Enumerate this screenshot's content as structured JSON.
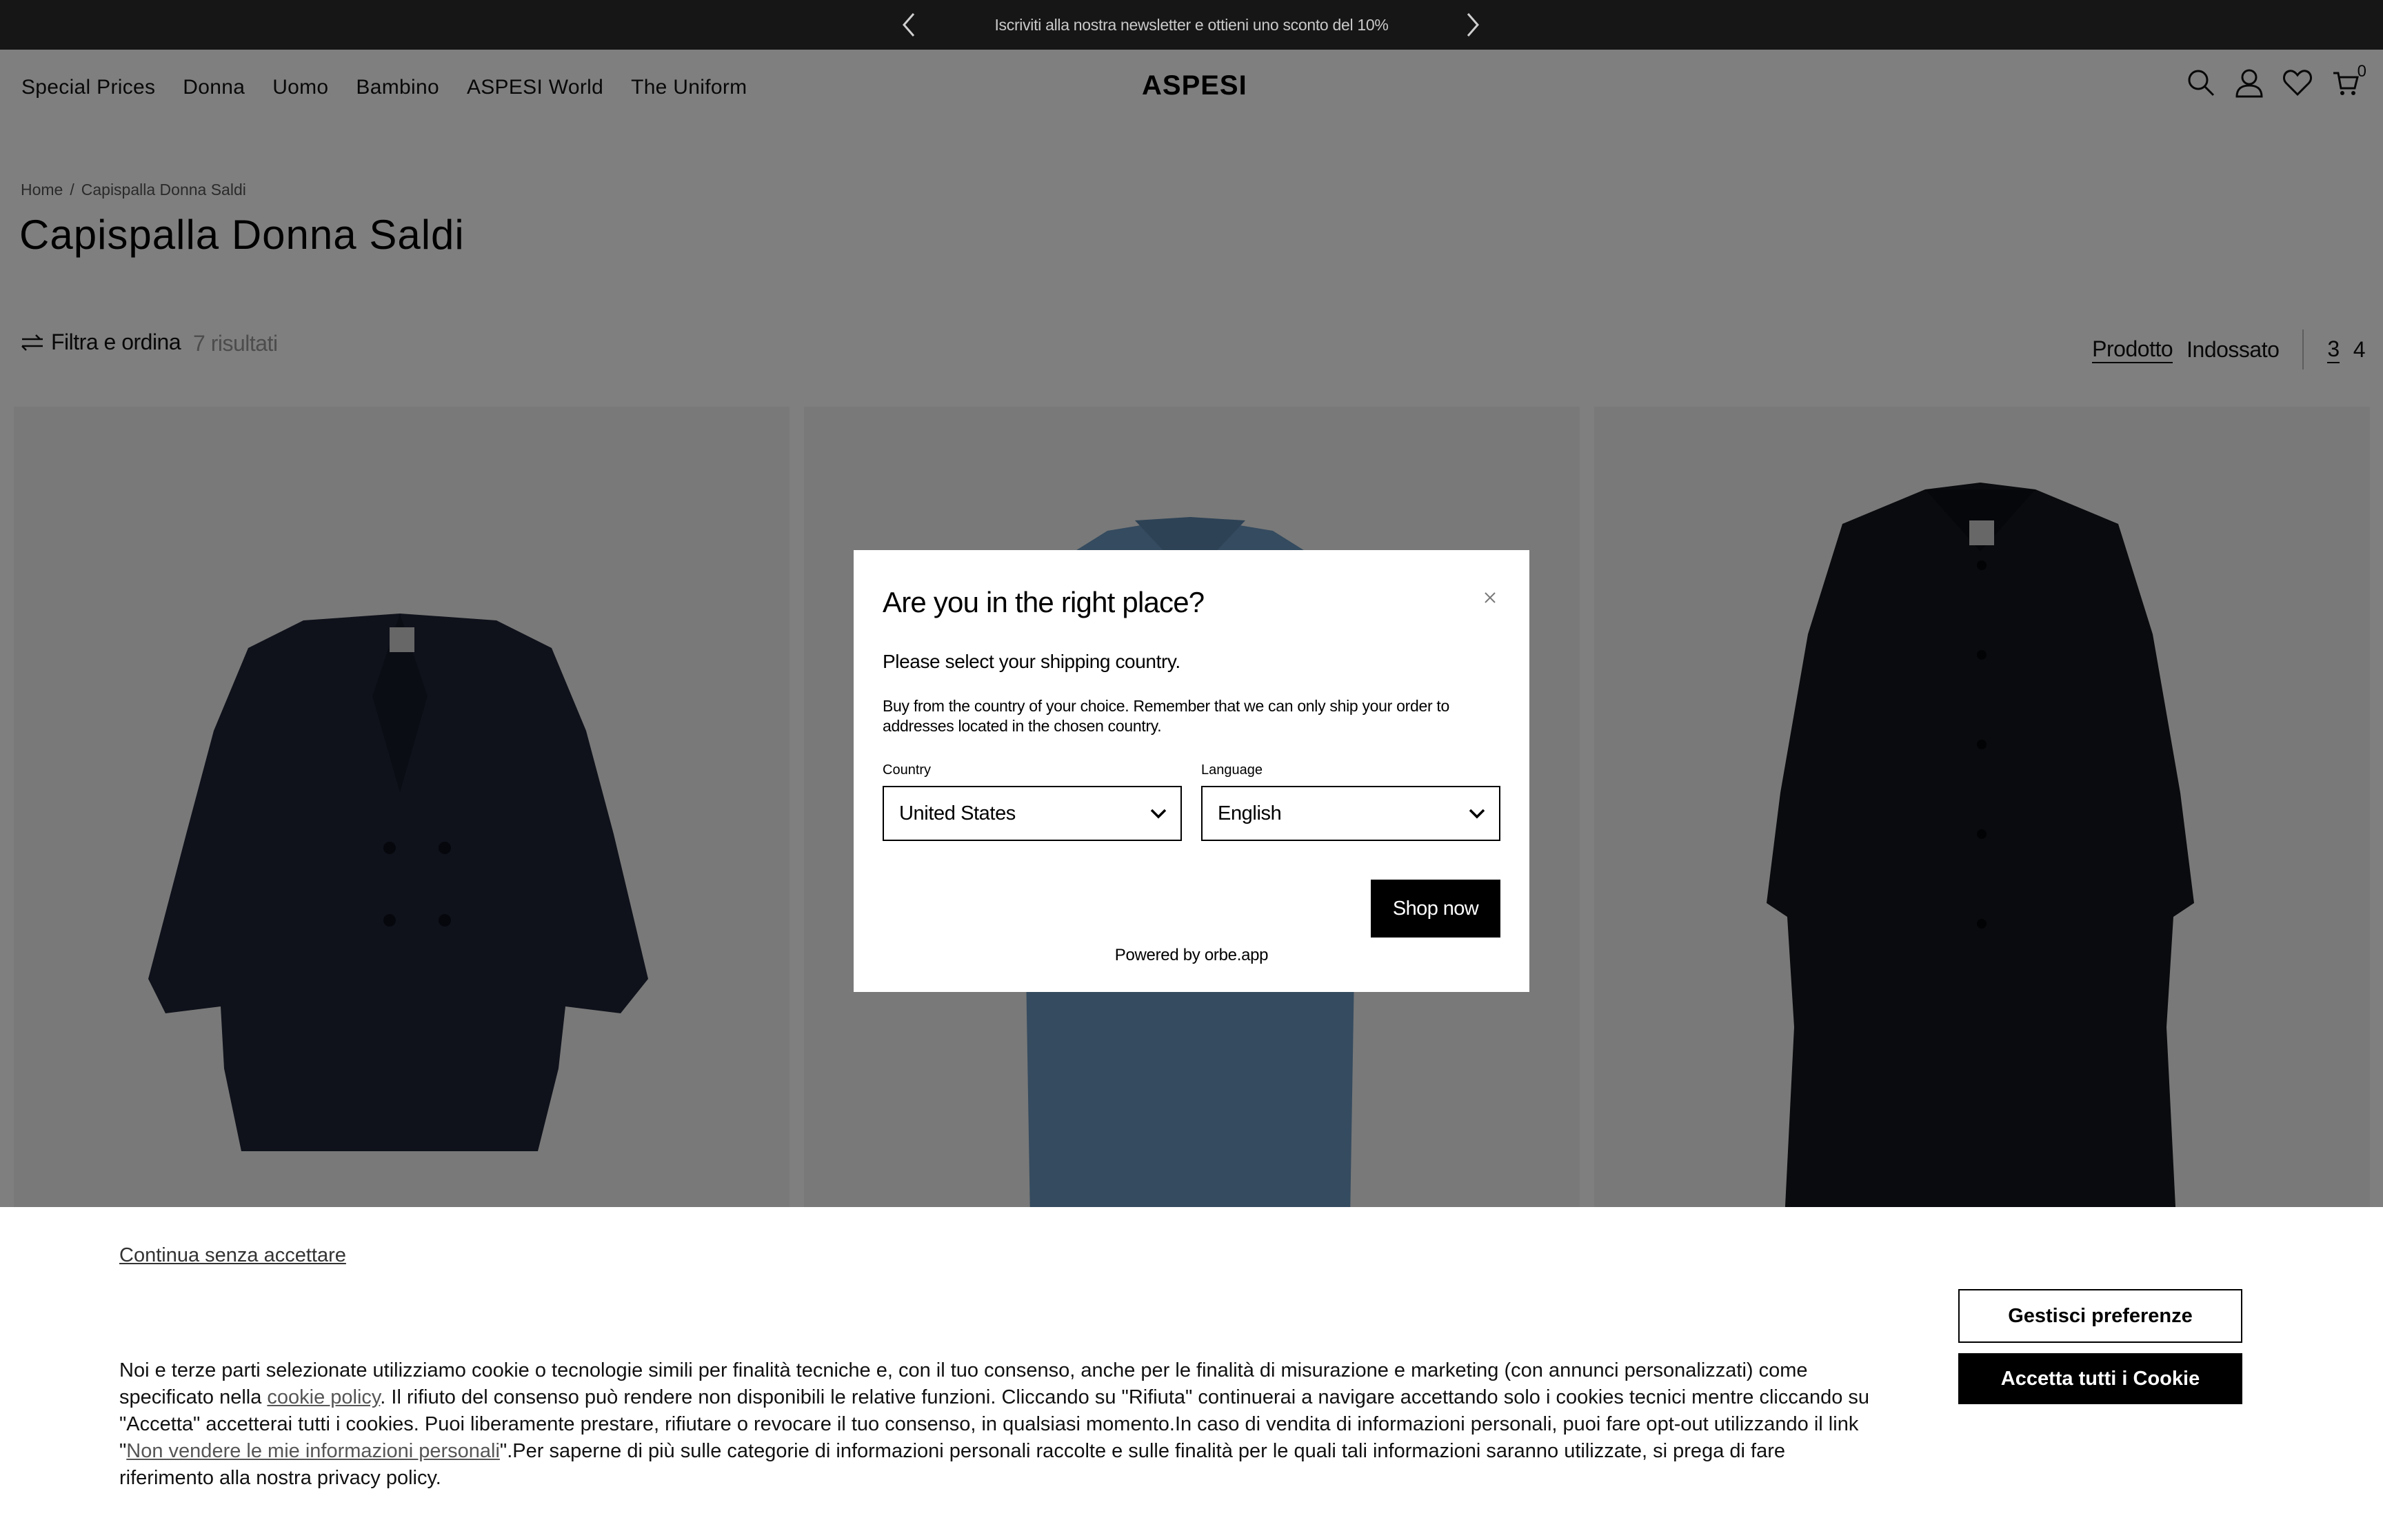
{
  "announcement": {
    "text": "Iscriviti alla nostra newsletter e ottieni uno sconto del 10%"
  },
  "header": {
    "nav": [
      "Special Prices",
      "Donna",
      "Uomo",
      "Bambino",
      "ASPESI World",
      "The Uniform"
    ],
    "logo": "ASPESI",
    "cart_count": "0"
  },
  "breadcrumb": {
    "home": "Home",
    "separator": "/",
    "current": "Capispalla Donna Saldi"
  },
  "page": {
    "title": "Capispalla Donna Saldi"
  },
  "toolbar": {
    "filter_label": "Filtra e ordina",
    "results": "7 risultati",
    "view_product": "Prodotto",
    "view_worn": "Indossato",
    "cols_3": "3",
    "cols_4": "4"
  },
  "modal": {
    "title": "Are you in the right place?",
    "subtitle": "Please select your shipping country.",
    "description": "Buy from the country of your choice. Remember that we can only ship your order to addresses located in the chosen country.",
    "country_label": "Country",
    "country_value": "United States",
    "language_label": "Language",
    "language_value": "English",
    "shop_button": "Shop now",
    "powered_by": "Powered by orbe.app"
  },
  "cookie": {
    "continue": "Continua senza accettare",
    "text_1": "Noi e terze parti selezionate utilizziamo cookie o tecnologie simili per finalità tecniche e, con il tuo consenso, anche per le finalità di misurazione e marketing (con annunci personalizzati) come specificato nella ",
    "link_policy": "cookie policy",
    "text_2": ". Il rifiuto del consenso può rendere non disponibili le relative funzioni. Cliccando su \"Rifiuta\" continuerai a navigare accettando solo i cookies tecnici mentre cliccando su \"Accetta\" accetterai tutti i cookies. Puoi liberamente prestare, rifiutare o revocare il tuo consenso, in qualsiasi momento.In caso di vendita di informazioni personali, puoi fare opt-out utilizzando il link \"",
    "link_optout": "Non vendere le mie informazioni personali",
    "text_3": "\".Per saperne di più sulle categorie di informazioni personali raccolte e sulle finalità per le quali tali informazioni saranno utilizzate, si prega di fare riferimento alla nostra privacy policy.",
    "btn_preferences": "Gestisci preferenze",
    "btn_accept": "Accetta tutti i Cookie"
  },
  "colors": {
    "accent": "#000000",
    "announcement_bg": "#161616",
    "overlay": "rgba(0,0,0,0.5)"
  }
}
